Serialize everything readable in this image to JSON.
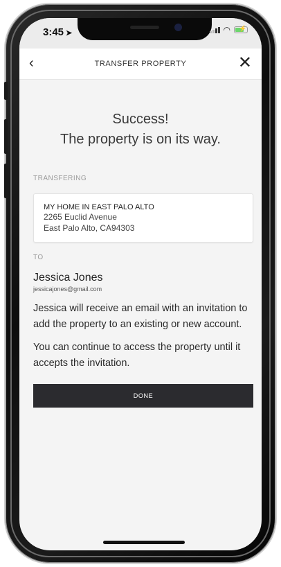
{
  "status_bar": {
    "time": "3:45",
    "location_arrow": "➤"
  },
  "header": {
    "title": "TRANSFER PROPERTY",
    "back_icon": "‹",
    "close_icon": "✕"
  },
  "success": {
    "line1": "Success!",
    "line2": "The property is on its way."
  },
  "transferring": {
    "label": "TRANSFERING",
    "property_name": "MY HOME IN EAST PALO ALTO",
    "address_line1": "2265 Euclid Avenue",
    "address_line2": "East Palo Alto, CA94303"
  },
  "to": {
    "label": "TO",
    "name": "Jessica Jones",
    "email": "jessicajones@gmail.com"
  },
  "messages": {
    "invitation": "Jessica will receive an email with an invitation to add the property to an existing or new account.",
    "access": "You can continue to access the property until it accepts the invitation."
  },
  "actions": {
    "done_label": "DONE"
  },
  "colors": {
    "button_bg": "#2b2b2f",
    "screen_bg": "#f4f4f4",
    "battery": "#6cd66c"
  }
}
